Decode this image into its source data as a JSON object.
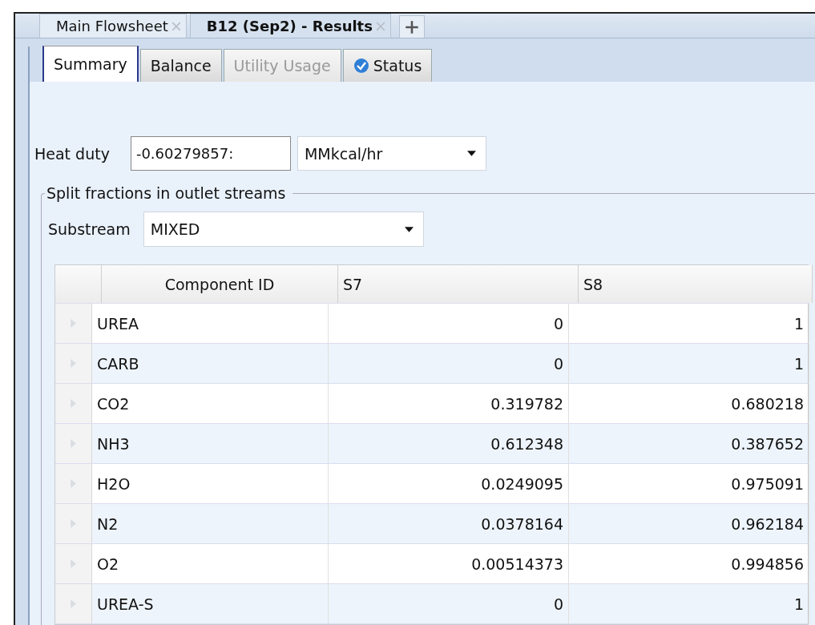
{
  "document_tabs": [
    {
      "label": "Main Flowsheet",
      "selected": false
    },
    {
      "label": "B12 (Sep2) - Results",
      "selected": true
    }
  ],
  "tabs": [
    {
      "label": "Summary",
      "selected": true,
      "disabled": false,
      "kind": "plain"
    },
    {
      "label": "Balance",
      "selected": false,
      "disabled": false,
      "kind": "plain"
    },
    {
      "label": "Utility Usage",
      "selected": false,
      "disabled": true,
      "kind": "plain"
    },
    {
      "label": "Status",
      "selected": false,
      "disabled": false,
      "kind": "status"
    }
  ],
  "heat_duty": {
    "label": "Heat duty",
    "value": "-0.60279857:",
    "unit": "MMkcal/hr"
  },
  "split_fractions": {
    "title": "Split fractions in outlet streams",
    "substream_label": "Substream",
    "substream": "MIXED",
    "table": {
      "columns": [
        "Component ID",
        "S7",
        "S8"
      ],
      "rows": [
        [
          "UREA",
          "0",
          "1"
        ],
        [
          "CARB",
          "0",
          "1"
        ],
        [
          "CO2",
          "0.319782",
          "0.680218"
        ],
        [
          "NH3",
          "0.612348",
          "0.387652"
        ],
        [
          "H2O",
          "0.0249095",
          "0.975091"
        ],
        [
          "N2",
          "0.0378164",
          "0.962184"
        ],
        [
          "O2",
          "0.00514373",
          "0.994856"
        ],
        [
          "UREA-S",
          "0",
          "1"
        ]
      ]
    }
  }
}
